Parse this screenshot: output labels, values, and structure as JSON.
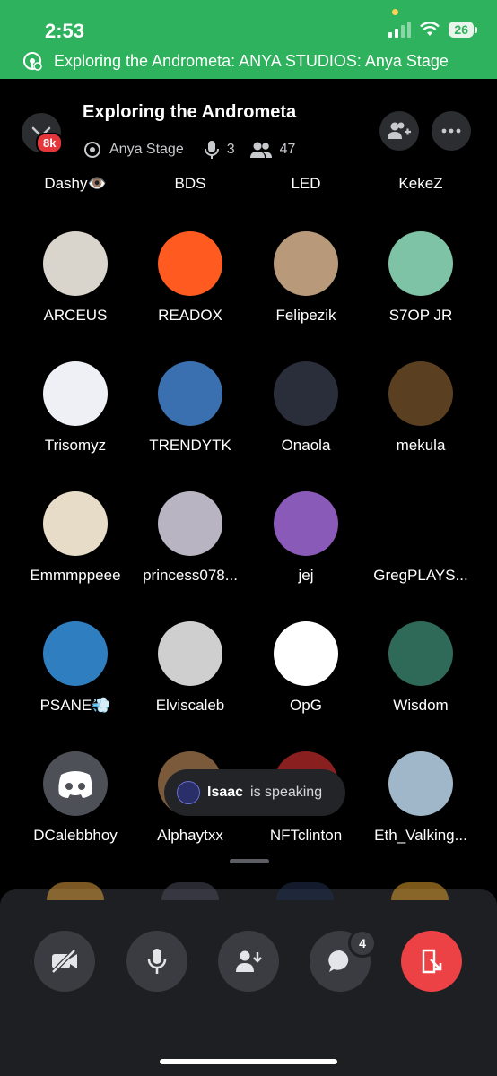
{
  "status_bar": {
    "time": "2:53",
    "battery": "26"
  },
  "banner": {
    "text": "Exploring the Andrometa: ANYA STUDIOS: Anya Stage"
  },
  "header": {
    "title": "Exploring the Andrometa",
    "stage_name": "Anya Stage",
    "speakers": "3",
    "listeners": "47",
    "badge": "8k"
  },
  "top_row": [
    "Dashy👁️",
    "BDS",
    "LED",
    "KekeZ"
  ],
  "participants": [
    {
      "name": "ARCEUS",
      "color": "#d9d4cc"
    },
    {
      "name": "READOX",
      "color": "#ff5a1f"
    },
    {
      "name": "Felipezik",
      "color": "#b89a7a"
    },
    {
      "name": "S7OP JR",
      "color": "#7fc3a6"
    },
    {
      "name": "Trisomyz",
      "color": "#eef0f6"
    },
    {
      "name": "TRENDYTK",
      "color": "#3a6fb0"
    },
    {
      "name": "Onaola",
      "color": "#2a2e3a"
    },
    {
      "name": "mekula",
      "color": "#5a4020"
    },
    {
      "name": "Emmmppeee",
      "color": "#e6dcc8"
    },
    {
      "name": "princess078...",
      "color": "#b8b4c2"
    },
    {
      "name": "jej",
      "color": "#8a5ab8"
    },
    {
      "name": "GregPLAYS...",
      "color": "#000000"
    },
    {
      "name": "PSANE💨",
      "color": "#2f7fc0"
    },
    {
      "name": "Elviscaleb",
      "color": "#cfcfcf"
    },
    {
      "name": "OpG",
      "color": "#ffffff"
    },
    {
      "name": "Wisdom",
      "color": "#2f6a58"
    },
    {
      "name": "DCalebbhoy",
      "color": "#4e5058"
    },
    {
      "name": "Alphaytxx",
      "color": "#7a5a3a"
    },
    {
      "name": "NFTclinton",
      "color": "#8a1f1f"
    },
    {
      "name": "Eth_Valking...",
      "color": "#9fb7c8"
    }
  ],
  "toast": {
    "name": "Isaac",
    "text": "is speaking"
  },
  "controls": {
    "chat_badge": "4"
  },
  "colors": {
    "status_green": "#2fb25d",
    "danger": "#ed4245",
    "sheet": "#1e1f22"
  }
}
